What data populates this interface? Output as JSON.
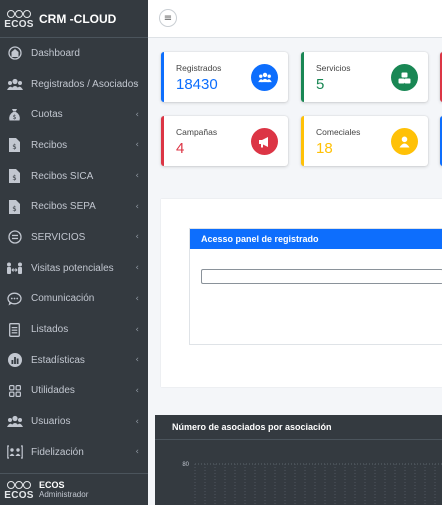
{
  "brand": {
    "logo_text": "ECOS",
    "title": "CRM -CLOUD"
  },
  "sidebar": {
    "items": [
      {
        "label": "Dashboard",
        "icon": "dashboard-icon",
        "chevron": false
      },
      {
        "label": "Registrados / Asociados",
        "icon": "users-icon",
        "chevron": true
      },
      {
        "label": "Cuotas",
        "icon": "money-bag-icon",
        "chevron": true
      },
      {
        "label": "Recibos",
        "icon": "receipt-icon",
        "chevron": true
      },
      {
        "label": "Recibos SICA",
        "icon": "receipt-icon",
        "chevron": true
      },
      {
        "label": "Recibos SEPA",
        "icon": "receipt-icon",
        "chevron": true
      },
      {
        "label": "SERVICIOS",
        "icon": "list-circle-icon",
        "chevron": true
      },
      {
        "label": "Visitas potenciales",
        "icon": "people-arrows-icon",
        "chevron": true
      },
      {
        "label": "Comunicación",
        "icon": "chat-icon",
        "chevron": true
      },
      {
        "label": "Listados",
        "icon": "list-doc-icon",
        "chevron": true
      },
      {
        "label": "Estadísticas",
        "icon": "bar-chart-icon",
        "chevron": true
      },
      {
        "label": "Utilidades",
        "icon": "grid-icon",
        "chevron": true
      },
      {
        "label": "Usuarios",
        "icon": "users-icon",
        "chevron": true
      },
      {
        "label": "Fidelización",
        "icon": "loyalty-icon",
        "chevron": true
      }
    ],
    "chevron_glyph": "‹"
  },
  "user": {
    "name": "ECOS",
    "role": "Administrador",
    "logo_text": "ECOS"
  },
  "topbar": {
    "menu_icon": "≡"
  },
  "stats": [
    {
      "label": "Registrados",
      "value": "18430",
      "color": "#0d6efd",
      "icon": "users-icon"
    },
    {
      "label": "Servicios",
      "value": "5",
      "color": "#198754",
      "icon": "cubes-icon"
    },
    {
      "label": "Campañas",
      "value": "4",
      "color": "#dc3545",
      "icon": "megaphone-icon"
    },
    {
      "label": "Comeciales",
      "value": "18",
      "color": "#ffc107",
      "icon": "user-icon"
    }
  ],
  "panel": {
    "title": "Acesso panel de registrado",
    "input_value": ""
  },
  "chart": {
    "title": "Número de asociados por asociación",
    "y_tick": "80"
  },
  "chart_data": {
    "type": "bar",
    "title": "Número de asociados por asociación",
    "y_ticks": [
      80
    ],
    "grid": true
  }
}
